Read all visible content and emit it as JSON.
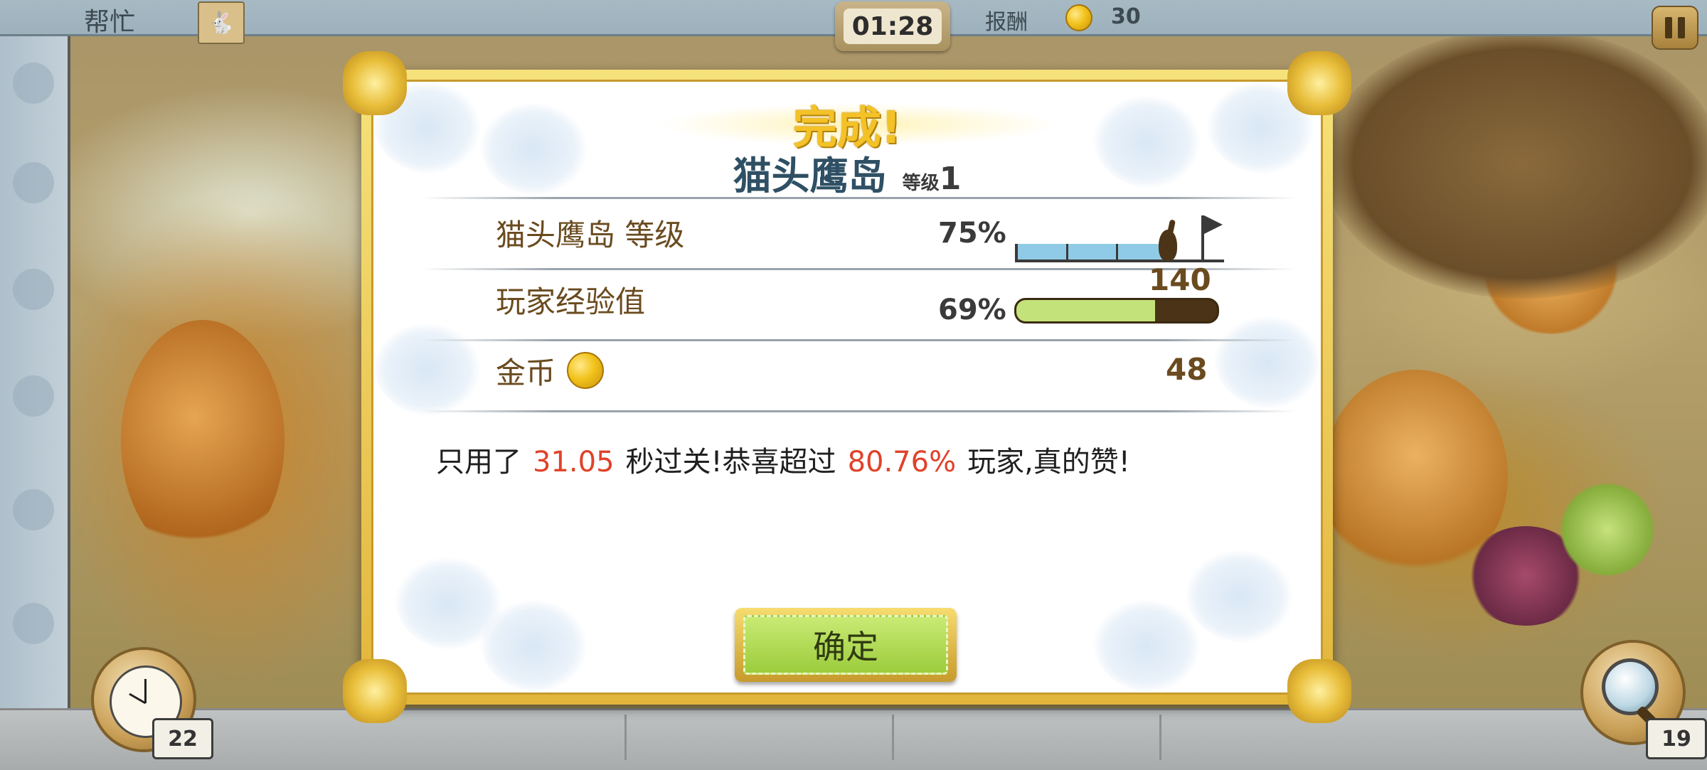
{
  "hud": {
    "help_label": "帮忙",
    "timer": "01:28",
    "reward_label": "报酬",
    "reward_value": "30",
    "clock_count": "22",
    "magnifier_count": "19"
  },
  "dialog": {
    "title": "完成!",
    "level_name": "猫头鹰岛",
    "level_label": "等级",
    "level_number": "1",
    "rows": {
      "island_level": {
        "label": "猫头鹰岛 等级",
        "percent": "75%",
        "progress": 0.75
      },
      "player_xp": {
        "label": "玩家经验值",
        "percent": "69%",
        "value": "140",
        "progress": 0.69
      },
      "coins": {
        "label": "金币",
        "value": "48"
      }
    },
    "message": {
      "part1": "只用了",
      "time": "31.05",
      "part2": "秒过关!恭喜超过",
      "rank": "80.76%",
      "part3": "玩家,真的赞!"
    },
    "confirm_label": "确定"
  },
  "colors": {
    "accent_gold": "#e8be3a",
    "highlight_red": "#e0422a",
    "xp_green": "#c4e27a",
    "island_blue": "#8fcbe6"
  },
  "icons": [
    "rabbit-icon",
    "coin-icon",
    "pause-icon",
    "clock-icon",
    "magnifier-icon",
    "flag-icon"
  ]
}
